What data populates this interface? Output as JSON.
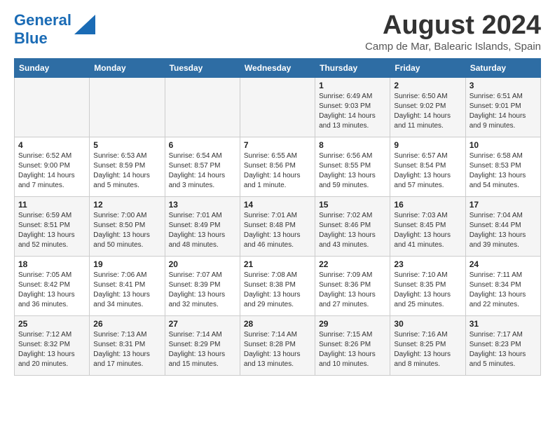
{
  "header": {
    "logo_line1": "General",
    "logo_line2": "Blue",
    "title": "August 2024",
    "subtitle": "Camp de Mar, Balearic Islands, Spain"
  },
  "weekdays": [
    "Sunday",
    "Monday",
    "Tuesday",
    "Wednesday",
    "Thursday",
    "Friday",
    "Saturday"
  ],
  "weeks": [
    [
      {
        "day": "",
        "info": ""
      },
      {
        "day": "",
        "info": ""
      },
      {
        "day": "",
        "info": ""
      },
      {
        "day": "",
        "info": ""
      },
      {
        "day": "1",
        "info": "Sunrise: 6:49 AM\nSunset: 9:03 PM\nDaylight: 14 hours\nand 13 minutes."
      },
      {
        "day": "2",
        "info": "Sunrise: 6:50 AM\nSunset: 9:02 PM\nDaylight: 14 hours\nand 11 minutes."
      },
      {
        "day": "3",
        "info": "Sunrise: 6:51 AM\nSunset: 9:01 PM\nDaylight: 14 hours\nand 9 minutes."
      }
    ],
    [
      {
        "day": "4",
        "info": "Sunrise: 6:52 AM\nSunset: 9:00 PM\nDaylight: 14 hours\nand 7 minutes."
      },
      {
        "day": "5",
        "info": "Sunrise: 6:53 AM\nSunset: 8:59 PM\nDaylight: 14 hours\nand 5 minutes."
      },
      {
        "day": "6",
        "info": "Sunrise: 6:54 AM\nSunset: 8:57 PM\nDaylight: 14 hours\nand 3 minutes."
      },
      {
        "day": "7",
        "info": "Sunrise: 6:55 AM\nSunset: 8:56 PM\nDaylight: 14 hours\nand 1 minute."
      },
      {
        "day": "8",
        "info": "Sunrise: 6:56 AM\nSunset: 8:55 PM\nDaylight: 13 hours\nand 59 minutes."
      },
      {
        "day": "9",
        "info": "Sunrise: 6:57 AM\nSunset: 8:54 PM\nDaylight: 13 hours\nand 57 minutes."
      },
      {
        "day": "10",
        "info": "Sunrise: 6:58 AM\nSunset: 8:53 PM\nDaylight: 13 hours\nand 54 minutes."
      }
    ],
    [
      {
        "day": "11",
        "info": "Sunrise: 6:59 AM\nSunset: 8:51 PM\nDaylight: 13 hours\nand 52 minutes."
      },
      {
        "day": "12",
        "info": "Sunrise: 7:00 AM\nSunset: 8:50 PM\nDaylight: 13 hours\nand 50 minutes."
      },
      {
        "day": "13",
        "info": "Sunrise: 7:01 AM\nSunset: 8:49 PM\nDaylight: 13 hours\nand 48 minutes."
      },
      {
        "day": "14",
        "info": "Sunrise: 7:01 AM\nSunset: 8:48 PM\nDaylight: 13 hours\nand 46 minutes."
      },
      {
        "day": "15",
        "info": "Sunrise: 7:02 AM\nSunset: 8:46 PM\nDaylight: 13 hours\nand 43 minutes."
      },
      {
        "day": "16",
        "info": "Sunrise: 7:03 AM\nSunset: 8:45 PM\nDaylight: 13 hours\nand 41 minutes."
      },
      {
        "day": "17",
        "info": "Sunrise: 7:04 AM\nSunset: 8:44 PM\nDaylight: 13 hours\nand 39 minutes."
      }
    ],
    [
      {
        "day": "18",
        "info": "Sunrise: 7:05 AM\nSunset: 8:42 PM\nDaylight: 13 hours\nand 36 minutes."
      },
      {
        "day": "19",
        "info": "Sunrise: 7:06 AM\nSunset: 8:41 PM\nDaylight: 13 hours\nand 34 minutes."
      },
      {
        "day": "20",
        "info": "Sunrise: 7:07 AM\nSunset: 8:39 PM\nDaylight: 13 hours\nand 32 minutes."
      },
      {
        "day": "21",
        "info": "Sunrise: 7:08 AM\nSunset: 8:38 PM\nDaylight: 13 hours\nand 29 minutes."
      },
      {
        "day": "22",
        "info": "Sunrise: 7:09 AM\nSunset: 8:36 PM\nDaylight: 13 hours\nand 27 minutes."
      },
      {
        "day": "23",
        "info": "Sunrise: 7:10 AM\nSunset: 8:35 PM\nDaylight: 13 hours\nand 25 minutes."
      },
      {
        "day": "24",
        "info": "Sunrise: 7:11 AM\nSunset: 8:34 PM\nDaylight: 13 hours\nand 22 minutes."
      }
    ],
    [
      {
        "day": "25",
        "info": "Sunrise: 7:12 AM\nSunset: 8:32 PM\nDaylight: 13 hours\nand 20 minutes."
      },
      {
        "day": "26",
        "info": "Sunrise: 7:13 AM\nSunset: 8:31 PM\nDaylight: 13 hours\nand 17 minutes."
      },
      {
        "day": "27",
        "info": "Sunrise: 7:14 AM\nSunset: 8:29 PM\nDaylight: 13 hours\nand 15 minutes."
      },
      {
        "day": "28",
        "info": "Sunrise: 7:14 AM\nSunset: 8:28 PM\nDaylight: 13 hours\nand 13 minutes."
      },
      {
        "day": "29",
        "info": "Sunrise: 7:15 AM\nSunset: 8:26 PM\nDaylight: 13 hours\nand 10 minutes."
      },
      {
        "day": "30",
        "info": "Sunrise: 7:16 AM\nSunset: 8:25 PM\nDaylight: 13 hours\nand 8 minutes."
      },
      {
        "day": "31",
        "info": "Sunrise: 7:17 AM\nSunset: 8:23 PM\nDaylight: 13 hours\nand 5 minutes."
      }
    ]
  ]
}
